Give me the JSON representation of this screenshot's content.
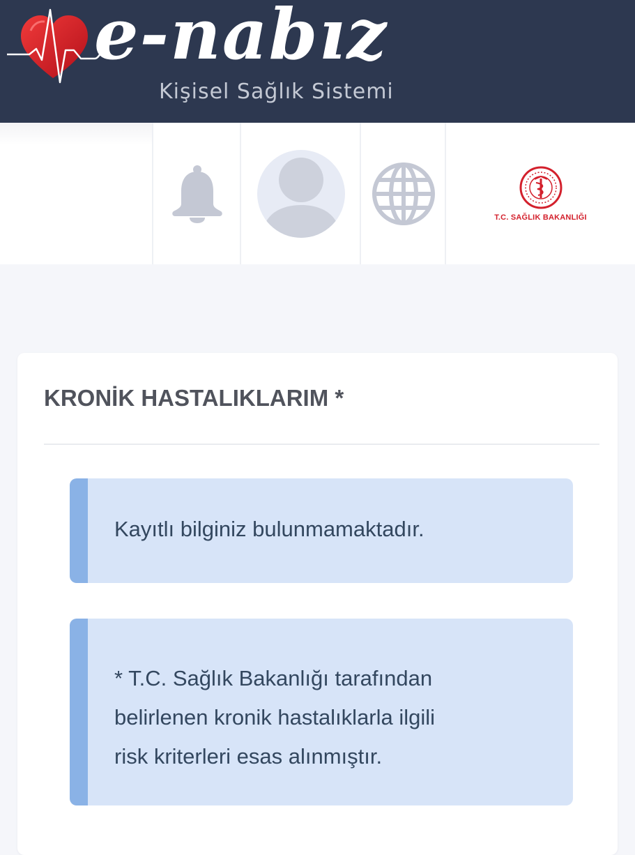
{
  "header": {
    "logo_text": "e-nabız",
    "subtitle": "Kişisel Sağlık Sistemi"
  },
  "toolbar": {
    "icons": [
      "bell-icon",
      "user-avatar-icon",
      "globe-icon"
    ],
    "ministry_name": "T.C. SAĞLIK BAKANLIĞI"
  },
  "card": {
    "title": "KRONİK HASTALIKLARIM *",
    "empty_message": "Kayıtlı bilginiz bulunmamaktadır.",
    "footnote_lines": [
      "* T.C. Sağlık Bakanlığı tarafından",
      "belirlenen kronik hastalıklarla ilgili",
      "risk kriterleri esas alınmıştır."
    ]
  },
  "colors": {
    "header_bg": "#2d3850",
    "page_bg": "#f5f6fa",
    "alert_bg": "#d7e4f8",
    "alert_border": "#8ab2e6",
    "icon_gray": "#c4c8d4",
    "brand_red": "#d3202c"
  }
}
